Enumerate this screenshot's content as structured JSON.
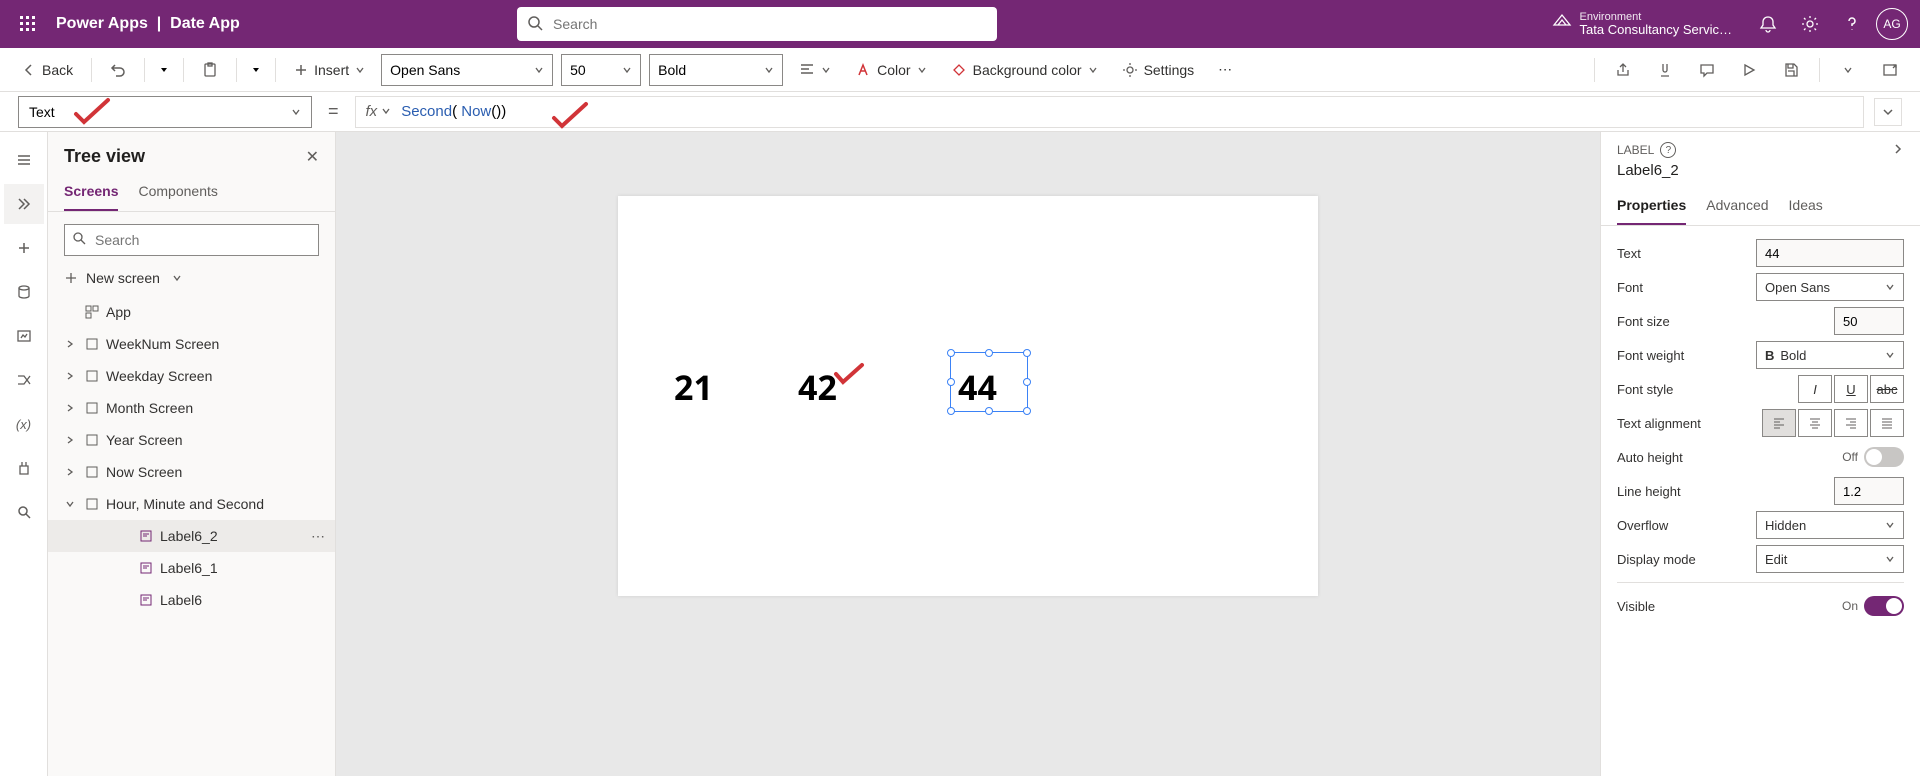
{
  "header": {
    "app_name": "Power Apps",
    "file_name": "Date App",
    "search_placeholder": "Search",
    "env_label": "Environment",
    "env_name": "Tata Consultancy Servic…",
    "avatar": "AG"
  },
  "cmdbar": {
    "back": "Back",
    "insert": "Insert",
    "font": "Open Sans",
    "font_size": "50",
    "font_weight": "Bold",
    "color": "Color",
    "bg_color": "Background color",
    "settings": "Settings"
  },
  "formula": {
    "property": "Text",
    "fx": "fx",
    "formula_fn1": "Second",
    "formula_open": "( ",
    "formula_fn2": "Now",
    "formula_close": "())"
  },
  "tree": {
    "title": "Tree view",
    "tab_screens": "Screens",
    "tab_components": "Components",
    "search_placeholder": "Search",
    "new_screen": "New screen",
    "app": "App",
    "items": [
      "WeekNum Screen",
      "Weekday Screen",
      "Month Screen",
      "Year Screen",
      "Now Screen",
      "Hour, Minute and Second"
    ],
    "children": [
      "Label6_2",
      "Label6_1",
      "Label6"
    ]
  },
  "canvas": {
    "label1": "21",
    "label2": "42",
    "label3": "44"
  },
  "props": {
    "type": "LABEL",
    "name": "Label6_2",
    "tab_properties": "Properties",
    "tab_advanced": "Advanced",
    "tab_ideas": "Ideas",
    "rows": {
      "text_label": "Text",
      "text_value": "44",
      "font_label": "Font",
      "font_value": "Open Sans",
      "fontsize_label": "Font size",
      "fontsize_value": "50",
      "fontweight_label": "Font weight",
      "fontweight_value": "Bold",
      "fontstyle_label": "Font style",
      "align_label": "Text alignment",
      "autoheight_label": "Auto height",
      "autoheight_value": "Off",
      "lineheight_label": "Line height",
      "lineheight_value": "1.2",
      "overflow_label": "Overflow",
      "overflow_value": "Hidden",
      "display_label": "Display mode",
      "display_value": "Edit",
      "visible_label": "Visible",
      "visible_value": "On"
    }
  }
}
